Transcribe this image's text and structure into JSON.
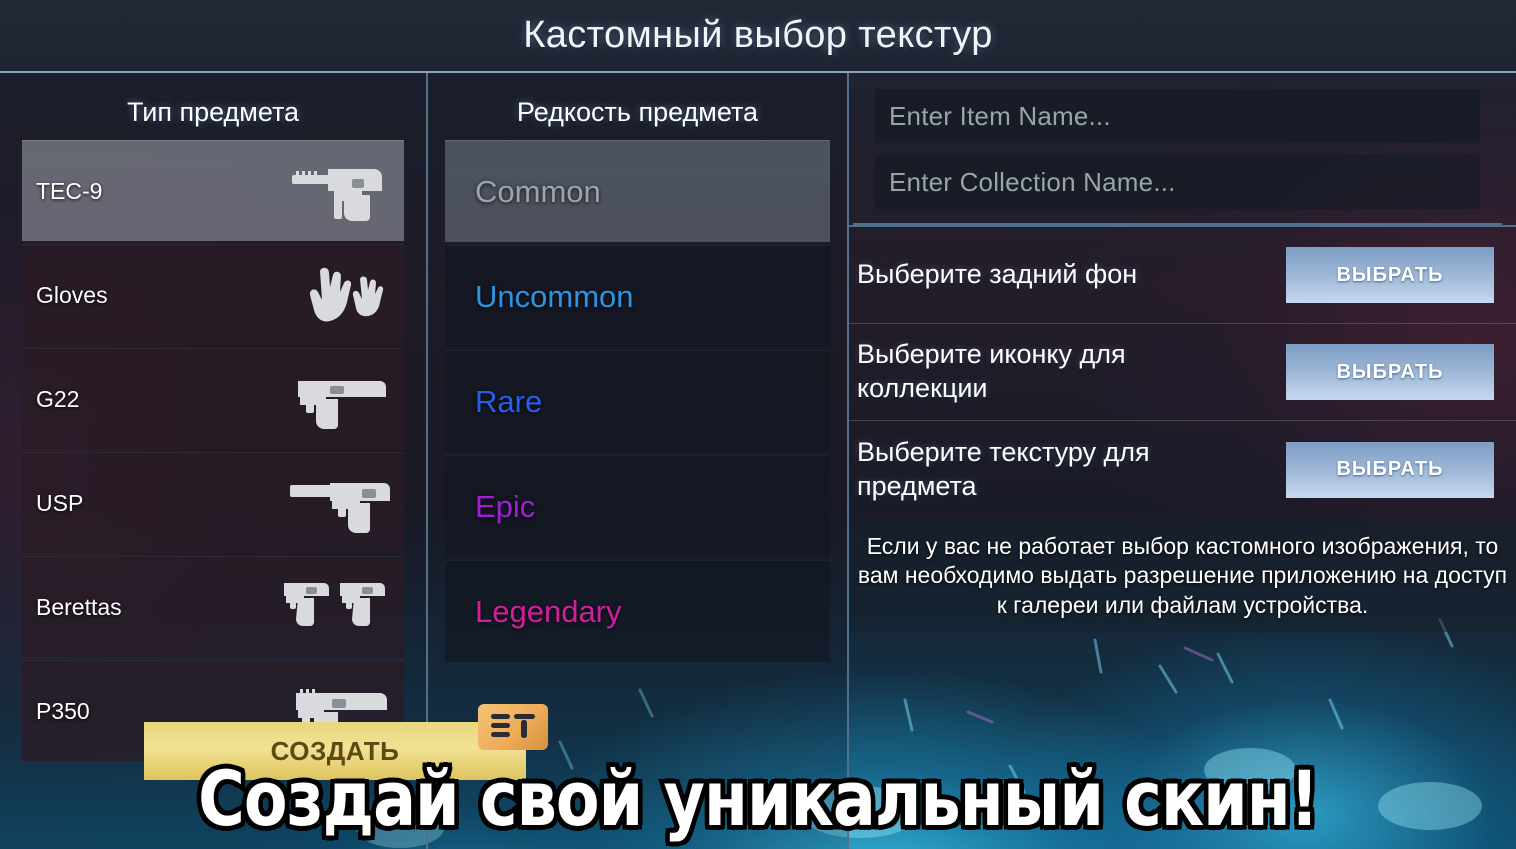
{
  "header": {
    "title": "Кастомный выбор текстур"
  },
  "type_column": {
    "heading": "Тип предмета",
    "items": [
      {
        "label": "TEC-9",
        "icon": "tec9-icon",
        "selected": true
      },
      {
        "label": "Gloves",
        "icon": "gloves-icon",
        "selected": false
      },
      {
        "label": "G22",
        "icon": "g22-icon",
        "selected": false
      },
      {
        "label": "USP",
        "icon": "usp-icon",
        "selected": false
      },
      {
        "label": "Berettas",
        "icon": "berettas-icon",
        "selected": false
      },
      {
        "label": "P350",
        "icon": "p350-icon",
        "selected": false
      }
    ]
  },
  "rarity_column": {
    "heading": "Редкость предмета",
    "items": [
      {
        "label": "Common",
        "color": "#9ba3ab",
        "selected": true
      },
      {
        "label": "Uncommon",
        "color": "#2f93e0",
        "selected": false
      },
      {
        "label": "Rare",
        "color": "#2a5ce8",
        "selected": false
      },
      {
        "label": "Epic",
        "color": "#a01fd6",
        "selected": false
      },
      {
        "label": "Legendary",
        "color": "#d01f9a",
        "selected": false
      }
    ]
  },
  "right_panel": {
    "item_name_placeholder": "Enter Item Name...",
    "collection_name_placeholder": "Enter Collection Name...",
    "item_name_value": "",
    "collection_name_value": "",
    "options": [
      {
        "label": "Выберите задний фон",
        "button": "ВЫБРАТЬ"
      },
      {
        "label": "Выберите иконку для коллекции",
        "button": "ВЫБРАТЬ"
      },
      {
        "label": "Выберите текстуру для предмета",
        "button": "ВЫБРАТЬ"
      }
    ],
    "notice_lines": [
      "Если у вас не работает выбор кастомного изображения, то",
      "вам необходимо выдать разрешение приложению на доступ",
      "к галереи или файлам устройства."
    ],
    "action_button": "СОЗДАТЬ"
  },
  "badge": {
    "text": "ST"
  },
  "caption": {
    "text": "Создай свой уникальный скин!"
  },
  "colors": {
    "accent_border": "#51708c",
    "button_blue": "#9ab4d4",
    "badge_gold": "#eead5a",
    "selected_row": "#787a85"
  }
}
